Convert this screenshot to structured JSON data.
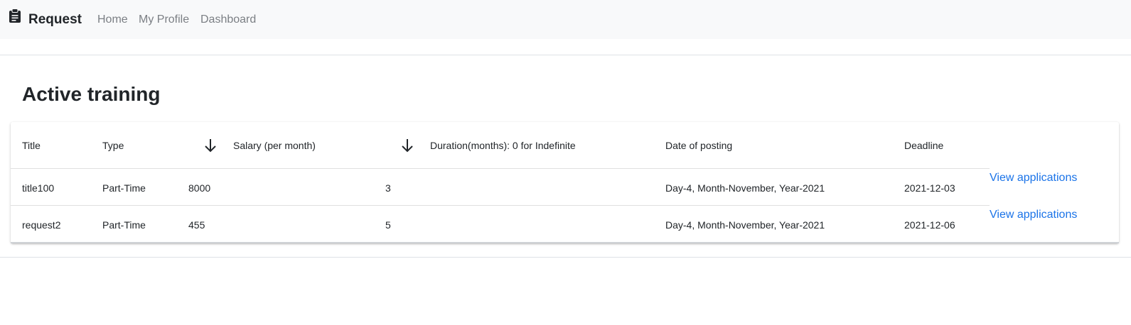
{
  "navbar": {
    "brand_icon": "clipboard-icon",
    "brand": "Request",
    "links": [
      "Home",
      "My Profile",
      "Dashboard"
    ]
  },
  "page": {
    "heading": "Active training"
  },
  "table": {
    "columns": [
      "Title",
      "Type",
      "Salary (per month)",
      "Duration(months): 0 for Indefinite",
      "Date of posting",
      "Deadline"
    ],
    "sort_icons": [
      "arrow-down-icon",
      "arrow-down-icon"
    ],
    "rows": [
      {
        "title": "title100",
        "type": "Part-Time",
        "salary": "8000",
        "duration": "3",
        "date_of_posting": "Day-4, Month-November, Year-2021",
        "deadline": "2021-12-03",
        "action": "View applications"
      },
      {
        "title": "request2",
        "type": "Part-Time",
        "salary": "455",
        "duration": "5",
        "date_of_posting": "Day-4, Month-November, Year-2021",
        "deadline": "2021-12-06",
        "action": "View applications"
      }
    ]
  },
  "colors": {
    "navbar_bg": "#f8f9fa",
    "link_blue": "#1a73e8",
    "nav_link": "#7b7f84"
  }
}
